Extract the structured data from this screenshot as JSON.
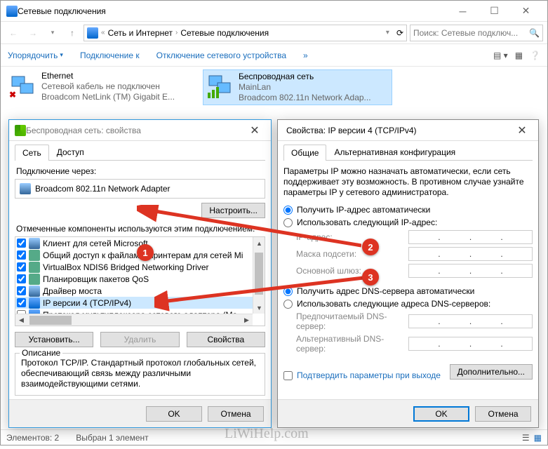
{
  "window": {
    "title": "Сетевые подключения",
    "address": {
      "part1": "Сеть и Интернет",
      "part2": "Сетевые подключения"
    },
    "search_placeholder": "Поиск: Сетевые подключ...",
    "toolbar": {
      "organize": "Упорядочить",
      "connect": "Подключение к",
      "disable": "Отключение сетевого устройства"
    },
    "connections": [
      {
        "name": "Ethernet",
        "status": "Сетевой кабель не подключен",
        "device": "Broadcom NetLink (TM) Gigabit E..."
      },
      {
        "name": "Беспроводная сеть",
        "status": "MainLan",
        "device": "Broadcom 802.11n Network Adap..."
      }
    ],
    "statusbar": {
      "count": "Элементов: 2",
      "selected": "Выбран 1 элемент"
    }
  },
  "dlg_props": {
    "title": "Беспроводная сеть: свойства",
    "tabs": {
      "net": "Сеть",
      "access": "Доступ"
    },
    "conn_via": "Подключение через:",
    "adapter": "Broadcom 802.11n Network Adapter",
    "configure": "Настроить...",
    "marked": "Отмеченные компоненты используются этим подключением:",
    "components": [
      "Клиент для сетей Microsoft",
      "Общий доступ к файлам и принтерам для сетей Mi",
      "VirtualBox NDIS6 Bridged Networking Driver",
      "Планировщик пакетов QoS",
      "Драйвер моста",
      "IP версии 4 (TCP/IPv4)",
      "Протокол мультиплексора сетевого адаптера (Ma"
    ],
    "install": "Установить...",
    "remove": "Удалить",
    "properties": "Свойства",
    "desc_label": "Описание",
    "desc_text": "Протокол TCP/IP. Стандартный протокол глобальных сетей, обеспечивающий связь между различными взаимодействующими сетями.",
    "ok": "OK",
    "cancel": "Отмена"
  },
  "dlg_ip": {
    "title": "Свойства: IP версии 4 (TCP/IPv4)",
    "tabs": {
      "general": "Общие",
      "alt": "Альтернативная конфигурация"
    },
    "para": "Параметры IP можно назначать автоматически, если сеть поддерживает эту возможность. В противном случае узнайте параметры IP у сетевого администратора.",
    "r_auto_ip": "Получить IP-адрес автоматически",
    "r_manual_ip": "Использовать следующий IP-адрес:",
    "f_ip": "IP-адрес:",
    "f_mask": "Маска подсети:",
    "f_gw": "Основной шлюз:",
    "r_auto_dns": "Получить адрес DNS-сервера автоматически",
    "r_manual_dns": "Использовать следующие адреса DNS-серверов:",
    "f_dns1": "Предпочитаемый DNS-сервер:",
    "f_dns2": "Альтернативный DNS-сервер:",
    "chk_validate": "Подтвердить параметры при выходе",
    "advanced": "Дополнительно...",
    "ok": "OK",
    "cancel": "Отмена"
  },
  "annotations": {
    "b1": "1",
    "b2": "2",
    "b3": "3"
  },
  "watermark": "LiWiHelp.com"
}
